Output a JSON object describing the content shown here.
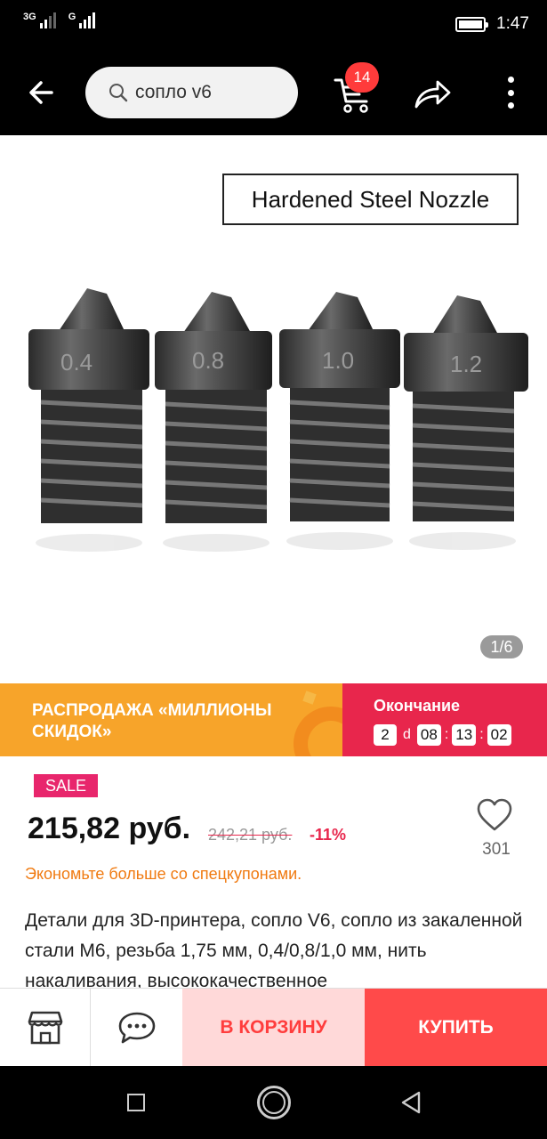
{
  "status_bar": {
    "network1": "3G",
    "network2": "G",
    "time": "1:47"
  },
  "header": {
    "search_query": "сопло v6",
    "cart_count": "14"
  },
  "gallery": {
    "image_caption": "Hardened Steel Nozzle",
    "nozzle_sizes": [
      "0.4",
      "0.8",
      "1.0",
      "1.2"
    ],
    "pager": "1/6"
  },
  "promo": {
    "title": "РАСПРОДАЖА «МИЛЛИОНЫ СКИДОК»",
    "ending_label": "Окончание",
    "days": "2",
    "days_unit": "d",
    "hours": "08",
    "minutes": "13",
    "seconds": "02",
    "left_color": "#f7a42a",
    "right_color": "#e8264c"
  },
  "product": {
    "sale_badge": "SALE",
    "price": "215,82 руб.",
    "old_price": "242,21 руб.",
    "discount": "-11%",
    "wishlist_count": "301",
    "coupon_text": "Экономьте больше со спецкупонами.",
    "description": "Детали для 3D-принтера, сопло V6, сопло из закаленной стали M6, резьба 1,75 мм, 0,4/0,8/1,0 мм, нить накаливания, высококачественное"
  },
  "actions": {
    "add_to_cart": "В КОРЗИНУ",
    "buy_now": "КУПИТЬ"
  }
}
